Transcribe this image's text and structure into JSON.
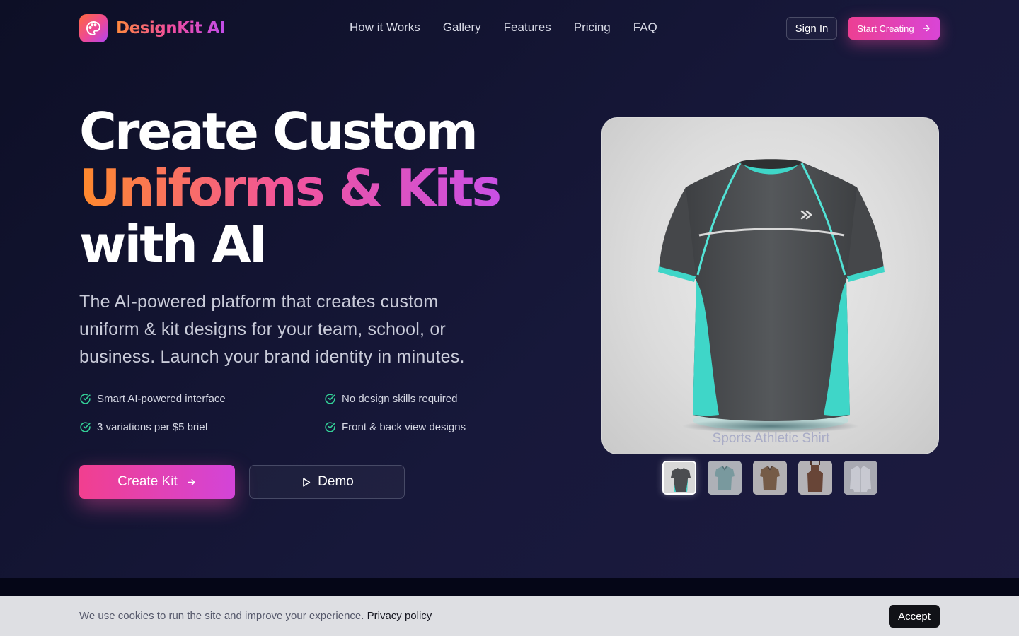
{
  "brand": {
    "name": "DesignKit AI",
    "icon": "palette-icon"
  },
  "nav": {
    "links": [
      "How it Works",
      "Gallery",
      "Features",
      "Pricing",
      "FAQ"
    ],
    "sign_in": "Sign In",
    "start_creating": "Start Creating"
  },
  "hero": {
    "title_line1": "Create Custom",
    "title_line2": "Uniforms & Kits",
    "title_line3": "with AI",
    "subtitle": "The AI-powered platform that creates custom uniform & kit designs for your team, school, or business. Launch your brand identity in minutes.",
    "features": [
      "Smart AI-powered interface",
      "No design skills required",
      "3 variations per $5 brief",
      "Front & back view designs"
    ],
    "cta_label": "Create Kit",
    "demo_label": "Demo"
  },
  "preview": {
    "caption": "Sports Athletic Shirt",
    "thumbnails": [
      "athletic-tshirt",
      "teal-polo",
      "brown-polo",
      "brown-apron",
      "white-dress-shirt"
    ],
    "selected_index": 0
  },
  "cookie": {
    "text": "We use cookies to run the site and improve your experience.",
    "link": "Privacy policy",
    "accept": "Accept"
  },
  "colors": {
    "accent_pink": "#ec4899",
    "accent_purple": "#c14de9",
    "accent_orange": "#ff8a3d",
    "check_green": "#34d399",
    "shirt_gray": "#4b4d50",
    "shirt_teal": "#3fd6c8"
  }
}
